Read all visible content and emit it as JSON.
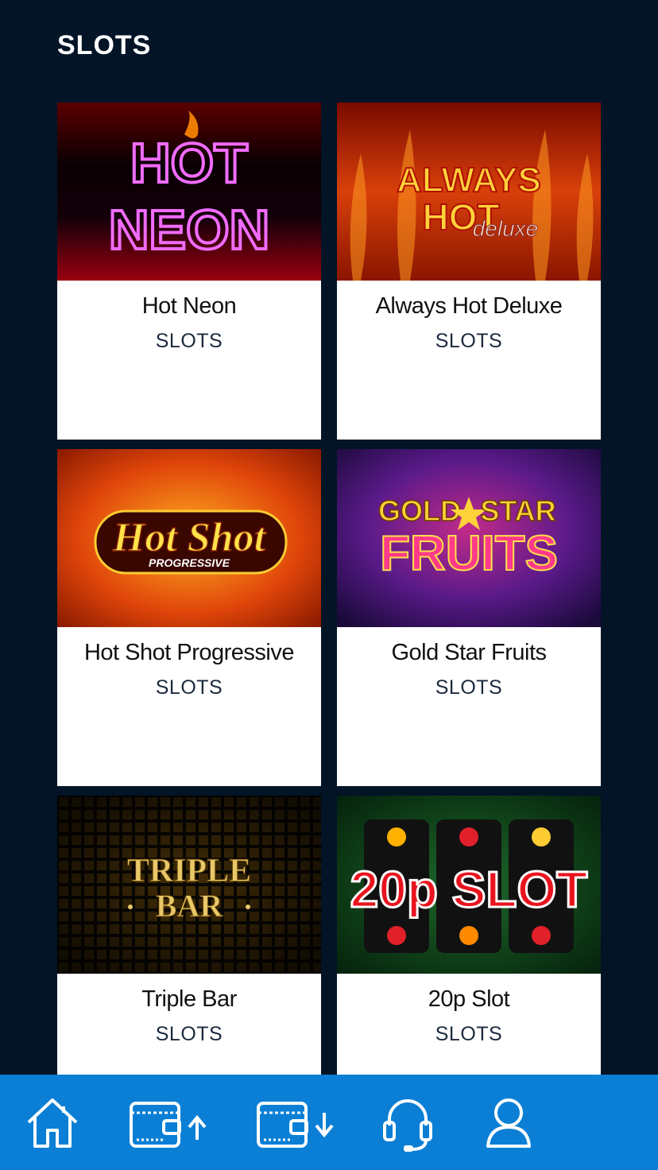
{
  "section": {
    "title": "SLOTS"
  },
  "games": [
    {
      "name": "Hot Neon",
      "category": "SLOTS",
      "art_text": [
        "HOT",
        "NEON"
      ]
    },
    {
      "name": "Always Hot Deluxe",
      "category": "SLOTS",
      "art_text": [
        "ALWAYS",
        "HOT",
        "deluxe"
      ]
    },
    {
      "name": "Hot Shot Progressive",
      "category": "SLOTS",
      "art_text": [
        "Hot Shot",
        "PROGRESSIVE"
      ]
    },
    {
      "name": "Gold Star Fruits",
      "category": "SLOTS",
      "art_text": [
        "GOLD",
        "STAR",
        "FRUITS"
      ]
    },
    {
      "name": "Triple Bar",
      "category": "SLOTS",
      "art_text": [
        "TRIPLE",
        "BAR"
      ]
    },
    {
      "name": "20p Slot",
      "category": "SLOTS",
      "art_text": [
        "20p SLOT"
      ]
    }
  ],
  "nav": {
    "items": [
      {
        "icon": "home-icon"
      },
      {
        "icon": "deposit-wallet-icon"
      },
      {
        "icon": "withdraw-wallet-icon"
      },
      {
        "icon": "support-headset-icon"
      },
      {
        "icon": "account-user-icon"
      }
    ]
  },
  "colors": {
    "background": "#021426",
    "card": "#ffffff",
    "nav": "#0a7fd5"
  }
}
